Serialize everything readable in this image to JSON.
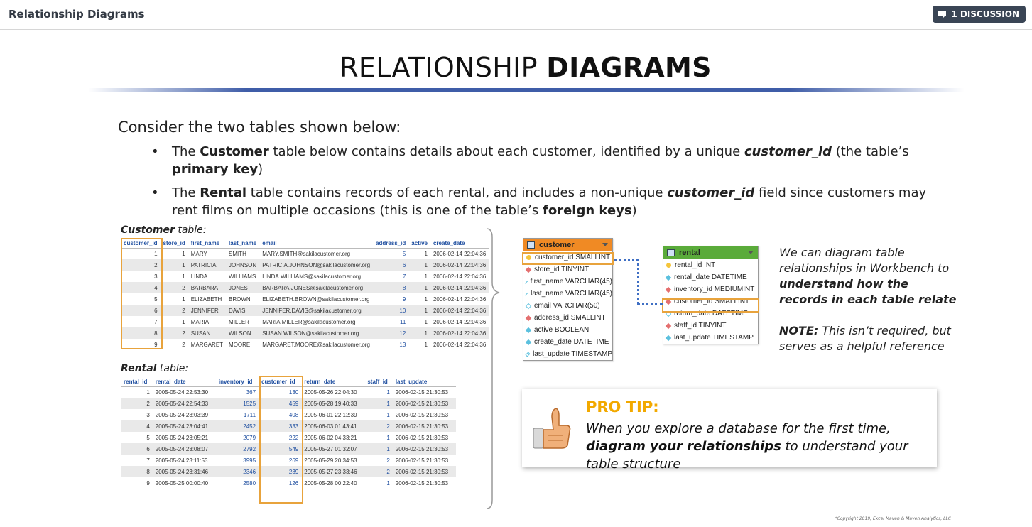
{
  "topbar": {
    "title": "Relationship Diagrams",
    "discussion_label": "1 DISCUSSION"
  },
  "slide": {
    "title_regular": "RELATIONSHIP ",
    "title_bold": "DIAGRAMS",
    "intro": "Consider the two tables shown below:",
    "bullet1": {
      "p1": "The ",
      "b1": "Customer",
      "p2": " table below contains details about each customer, identified by a unique ",
      "bi1": "customer_id",
      "p3": " (the table’s ",
      "b2": "primary key",
      "p4": ")"
    },
    "bullet2": {
      "p1": "The ",
      "b1": "Rental",
      "p2": " table contains records of each rental, and includes a non-unique ",
      "bi1": "customer_id",
      "p3": " field since customers may rent films on multiple occasions (this is one of the table’s ",
      "b2": "foreign keys",
      "p4": ")"
    }
  },
  "customer_table": {
    "label_bold": "Customer",
    "label_rest": " table:",
    "headers": [
      "customer_id",
      "store_id",
      "first_name",
      "last_name",
      "email",
      "address_id",
      "active",
      "create_date"
    ],
    "rows": [
      [
        "1",
        "1",
        "MARY",
        "SMITH",
        "MARY.SMITH@sakilacustomer.org",
        "5",
        "1",
        "2006-02-14 22:04:36"
      ],
      [
        "2",
        "1",
        "PATRICIA",
        "JOHNSON",
        "PATRICIA.JOHNSON@sakilacustomer.org",
        "6",
        "1",
        "2006-02-14 22:04:36"
      ],
      [
        "3",
        "1",
        "LINDA",
        "WILLIAMS",
        "LINDA.WILLIAMS@sakilacustomer.org",
        "7",
        "1",
        "2006-02-14 22:04:36"
      ],
      [
        "4",
        "2",
        "BARBARA",
        "JONES",
        "BARBARA.JONES@sakilacustomer.org",
        "8",
        "1",
        "2006-02-14 22:04:36"
      ],
      [
        "5",
        "1",
        "ELIZABETH",
        "BROWN",
        "ELIZABETH.BROWN@sakilacustomer.org",
        "9",
        "1",
        "2006-02-14 22:04:36"
      ],
      [
        "6",
        "2",
        "JENNIFER",
        "DAVIS",
        "JENNIFER.DAVIS@sakilacustomer.org",
        "10",
        "1",
        "2006-02-14 22:04:36"
      ],
      [
        "7",
        "1",
        "MARIA",
        "MILLER",
        "MARIA.MILLER@sakilacustomer.org",
        "11",
        "1",
        "2006-02-14 22:04:36"
      ],
      [
        "8",
        "2",
        "SUSAN",
        "WILSON",
        "SUSAN.WILSON@sakilacustomer.org",
        "12",
        "1",
        "2006-02-14 22:04:36"
      ],
      [
        "9",
        "2",
        "MARGARET",
        "MOORE",
        "MARGARET.MOORE@sakilacustomer.org",
        "13",
        "1",
        "2006-02-14 22:04:36"
      ]
    ]
  },
  "rental_table": {
    "label_bold": "Rental",
    "label_rest": " table:",
    "headers": [
      "rental_id",
      "rental_date",
      "inventory_id",
      "customer_id",
      "return_date",
      "staff_id",
      "last_update"
    ],
    "rows": [
      [
        "1",
        "2005-05-24 22:53:30",
        "367",
        "130",
        "2005-05-26 22:04:30",
        "1",
        "2006-02-15 21:30:53"
      ],
      [
        "2",
        "2005-05-24 22:54:33",
        "1525",
        "459",
        "2005-05-28 19:40:33",
        "1",
        "2006-02-15 21:30:53"
      ],
      [
        "3",
        "2005-05-24 23:03:39",
        "1711",
        "408",
        "2005-06-01 22:12:39",
        "1",
        "2006-02-15 21:30:53"
      ],
      [
        "4",
        "2005-05-24 23:04:41",
        "2452",
        "333",
        "2005-06-03 01:43:41",
        "2",
        "2006-02-15 21:30:53"
      ],
      [
        "5",
        "2005-05-24 23:05:21",
        "2079",
        "222",
        "2005-06-02 04:33:21",
        "1",
        "2006-02-15 21:30:53"
      ],
      [
        "6",
        "2005-05-24 23:08:07",
        "2792",
        "549",
        "2005-05-27 01:32:07",
        "1",
        "2006-02-15 21:30:53"
      ],
      [
        "7",
        "2005-05-24 23:11:53",
        "3995",
        "269",
        "2005-05-29 20:34:53",
        "2",
        "2006-02-15 21:30:53"
      ],
      [
        "8",
        "2005-05-24 23:31:46",
        "2346",
        "239",
        "2005-05-27 23:33:46",
        "2",
        "2006-02-15 21:30:53"
      ],
      [
        "9",
        "2005-05-25 00:00:40",
        "2580",
        "126",
        "2005-05-28 00:22:40",
        "1",
        "2006-02-15 21:30:53"
      ]
    ]
  },
  "er_diagram": {
    "customer": {
      "name": "customer",
      "header_color": "#f08a24",
      "columns": [
        {
          "label": "customer_id SMALLINT",
          "key": "pk"
        },
        {
          "label": "store_id TINYINT",
          "key": "fk"
        },
        {
          "label": "first_name VARCHAR(45)",
          "key": "col"
        },
        {
          "label": "last_name VARCHAR(45)",
          "key": "col"
        },
        {
          "label": "email VARCHAR(50)",
          "key": "null"
        },
        {
          "label": "address_id SMALLINT",
          "key": "fk"
        },
        {
          "label": "active BOOLEAN",
          "key": "col"
        },
        {
          "label": "create_date DATETIME",
          "key": "col"
        },
        {
          "label": "last_update TIMESTAMP",
          "key": "null"
        }
      ]
    },
    "rental": {
      "name": "rental",
      "header_color": "#5aab3a",
      "columns": [
        {
          "label": "rental_id INT",
          "key": "pk"
        },
        {
          "label": "rental_date DATETIME",
          "key": "col"
        },
        {
          "label": "inventory_id MEDIUMINT",
          "key": "fk"
        },
        {
          "label": "customer_id SMALLINT",
          "key": "fk"
        },
        {
          "label": "return_date DATETIME",
          "key": "null"
        },
        {
          "label": "staff_id TINYINT",
          "key": "fk"
        },
        {
          "label": "last_update TIMESTAMP",
          "key": "col"
        }
      ]
    },
    "connector_color": "#3f6fc4",
    "highlight_color": "#e8a33c"
  },
  "side_note": {
    "p1_a": "We can diagram table relationships in Workbench to ",
    "p1_b": "understand how the records in each table relate",
    "p2_a": "NOTE:",
    "p2_b": " This isn’t required, but serves as a helpful reference"
  },
  "pro_tip": {
    "title": "PRO TIP:",
    "t1": "When you explore a database for the first time, ",
    "t2": "diagram your relationships",
    "t3": " to understand your table structure",
    "title_color": "#f2a900"
  },
  "copyright": "*Copyright 2019, Excel Maven & Maven Analytics, LLC",
  "icons": [
    "chat-icon",
    "thumbs-up-icon",
    "table-icon",
    "primary-key-icon",
    "foreign-key-icon",
    "column-icon"
  ]
}
